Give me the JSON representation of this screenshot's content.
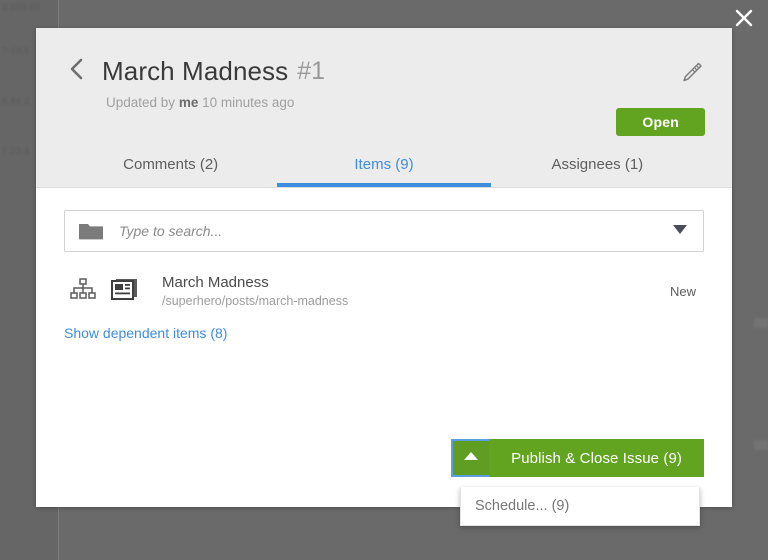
{
  "overlay": {
    "close_icon": "close-icon",
    "background_lines": [
      "3.159.69",
      "7-49.5",
      "8.44.2",
      "7.23.4"
    ]
  },
  "modal": {
    "header": {
      "back_icon": "chevron-left-icon",
      "title": "March Madness",
      "number": "#1",
      "updated_prefix": "Updated by",
      "updated_user": "me",
      "updated_suffix": "10 minutes ago",
      "edit_icon": "pencil-icon",
      "status_label": "Open",
      "status_color": "#62a420"
    },
    "tabs": [
      {
        "label": "Comments (2)",
        "active": false
      },
      {
        "label": "Items (9)",
        "active": true
      },
      {
        "label": "Assignees (1)",
        "active": false
      }
    ],
    "tab_accent_color": "#3f8ddd",
    "search": {
      "folder_icon": "folder-icon",
      "placeholder": "Type to search...",
      "value": "",
      "caret_icon": "caret-down-icon"
    },
    "items": [
      {
        "hierarchy_icon": "sitemap-icon",
        "type_icon": "page-icon",
        "title": "March Madness",
        "path": "/superhero/posts/march-madness",
        "status": "New"
      }
    ],
    "dependent_link": "Show dependent items (8)",
    "footer": {
      "toggle_icon": "caret-up-icon",
      "primary_label": "Publish & Close Issue (9)",
      "primary_color": "#62a420",
      "focus_outline_color": "#5c9fe0"
    },
    "dropdown": {
      "items": [
        "Schedule... (9)"
      ]
    }
  }
}
